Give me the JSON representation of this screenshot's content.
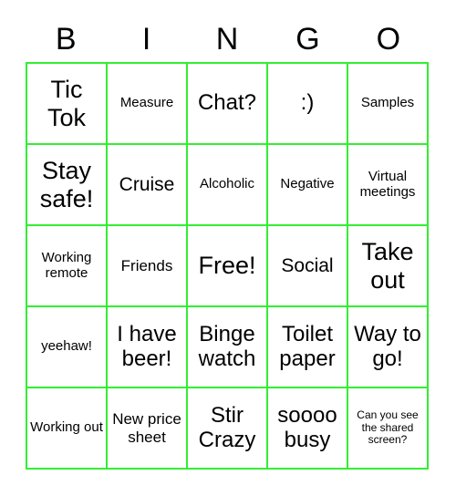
{
  "card": {
    "title": "BINGO",
    "border_color": "#33ee33",
    "text_color": "#000000",
    "background_color": "#ffffff",
    "columns": 5,
    "rows": 5
  },
  "header": {
    "letters": [
      "B",
      "I",
      "N",
      "G",
      "O"
    ]
  },
  "grid": {
    "cells": [
      {
        "text": "Tic Tok",
        "size": "fs-xl"
      },
      {
        "text": "Measure",
        "size": "fs-xs"
      },
      {
        "text": "Chat?",
        "size": "fs-lg"
      },
      {
        "text": ":)",
        "size": "fs-lg"
      },
      {
        "text": "Samples",
        "size": "fs-xs"
      },
      {
        "text": "Stay safe!",
        "size": "fs-xl"
      },
      {
        "text": "Cruise",
        "size": "fs-md"
      },
      {
        "text": "Alcoholic",
        "size": "fs-xs"
      },
      {
        "text": "Negative",
        "size": "fs-xs"
      },
      {
        "text": "Virtual meetings",
        "size": "fs-xs"
      },
      {
        "text": "Working remote",
        "size": "fs-xs"
      },
      {
        "text": "Friends",
        "size": "fs-sm"
      },
      {
        "text": "Free!",
        "size": "fs-xl"
      },
      {
        "text": "Social",
        "size": "fs-md"
      },
      {
        "text": "Take out",
        "size": "fs-xl"
      },
      {
        "text": "yeehaw!",
        "size": "fs-xs"
      },
      {
        "text": "I have beer!",
        "size": "fs-lg"
      },
      {
        "text": "Binge watch",
        "size": "fs-lg"
      },
      {
        "text": "Toilet paper",
        "size": "fs-lg"
      },
      {
        "text": "Way to go!",
        "size": "fs-lg"
      },
      {
        "text": "Working out",
        "size": "fs-xs"
      },
      {
        "text": "New price sheet",
        "size": "fs-sm"
      },
      {
        "text": "Stir Crazy",
        "size": "fs-lg"
      },
      {
        "text": "soooo busy",
        "size": "fs-lg"
      },
      {
        "text": "Can you see the shared screen?",
        "size": "fs-xxs"
      }
    ]
  }
}
